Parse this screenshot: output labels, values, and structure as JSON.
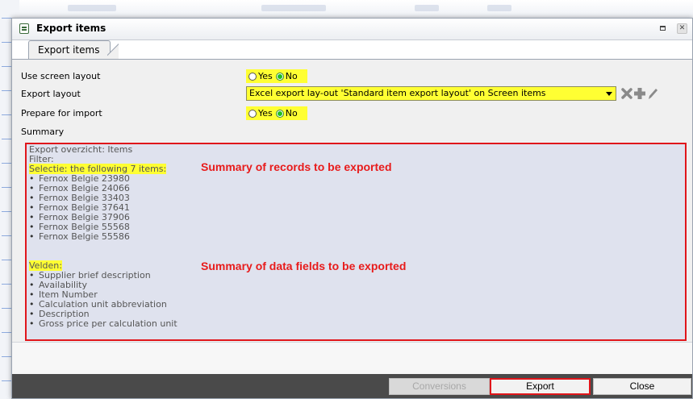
{
  "dialog": {
    "title": "Export items",
    "tab_label": "Export items"
  },
  "form": {
    "use_screen_layout": {
      "label": "Use screen layout",
      "options": [
        "Yes",
        "No"
      ],
      "selected": "No"
    },
    "export_layout": {
      "label": "Export layout",
      "value": "Excel export lay-out 'Standard item export layout' on Screen items"
    },
    "prepare_for_import": {
      "label": "Prepare for import",
      "options": [
        "Yes",
        "No"
      ],
      "selected": "No"
    },
    "summary_label": "Summary"
  },
  "toolbar_icons": [
    "delete-icon",
    "add-icon",
    "edit-icon"
  ],
  "summary": {
    "header": "Export overzicht: Items",
    "filter": "Filter:",
    "selection_heading": "Selectie: the following 7 items:",
    "items": [
      "Fernox Belgie 23980",
      "Fernox Belgie 24066",
      "Fernox Belgie 33403",
      "Fernox Belgie 37641",
      "Fernox Belgie 37906",
      "Fernox Belgie 55568",
      "Fernox Belgie 55586"
    ],
    "fields_heading": "Velden:",
    "fields": [
      "Supplier brief description",
      "Availability",
      "Item Number",
      "Calculation unit abbreviation",
      "Description",
      "Gross price per calculation unit"
    ]
  },
  "annotations": {
    "records": "Summary of records to be exported",
    "fields": "Summary of data fields to be exported"
  },
  "footer": {
    "conversions_label": "Conversions",
    "export_label": "Export",
    "close_label": "Close"
  },
  "colors": {
    "highlight": "#ffff33",
    "annotation_red": "#e81b1b",
    "summary_bg": "#dfe2ee",
    "footer_bg": "#4a4a4a",
    "radio_on": "#1fbf1f"
  }
}
